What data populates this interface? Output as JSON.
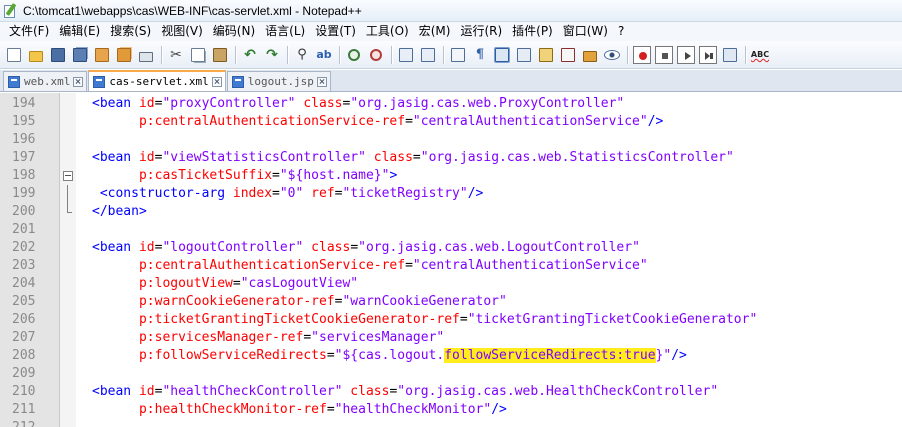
{
  "window": {
    "title": "C:\\tomcat1\\webapps\\cas\\WEB-INF\\cas-servlet.xml - Notepad++"
  },
  "menu": [
    "文件(F)",
    "编辑(E)",
    "搜索(S)",
    "视图(V)",
    "编码(N)",
    "语言(L)",
    "设置(T)",
    "工具(O)",
    "宏(M)",
    "运行(R)",
    "插件(P)",
    "窗口(W)",
    "?"
  ],
  "tabs": [
    {
      "label": "web.xml",
      "active": false
    },
    {
      "label": "cas-servlet.xml",
      "active": true
    },
    {
      "label": "logout.jsp",
      "active": false
    }
  ],
  "colors": {
    "tag": "#0000ff",
    "attribute": "#ff0000",
    "value": "#8000ff",
    "highlight": "#ffee1c",
    "active_tab_accent": "#f9a94a"
  },
  "lines": [
    {
      "n": "194",
      "fold": "",
      "tokens": [
        [
          "tag",
          "<bean "
        ],
        [
          "attr",
          "id"
        ],
        [
          "eq",
          "="
        ],
        [
          "val",
          "\"proxyController\""
        ],
        [
          "eq",
          " "
        ],
        [
          "attr",
          "class"
        ],
        [
          "eq",
          "="
        ],
        [
          "val",
          "\"org.jasig.cas.web.ProxyController\""
        ]
      ]
    },
    {
      "n": "195",
      "fold": "",
      "tokens": [
        [
          "eq",
          "      "
        ],
        [
          "attr",
          "p:centralAuthenticationService-ref"
        ],
        [
          "eq",
          "="
        ],
        [
          "val",
          "\"centralAuthenticationService\""
        ],
        [
          "tag",
          "/>"
        ]
      ]
    },
    {
      "n": "196",
      "fold": "",
      "tokens": []
    },
    {
      "n": "197",
      "fold": "",
      "tokens": [
        [
          "tag",
          "<bean "
        ],
        [
          "attr",
          "id"
        ],
        [
          "eq",
          "="
        ],
        [
          "val",
          "\"viewStatisticsController\""
        ],
        [
          "eq",
          " "
        ],
        [
          "attr",
          "class"
        ],
        [
          "eq",
          "="
        ],
        [
          "val",
          "\"org.jasig.cas.web.StatisticsController\""
        ]
      ]
    },
    {
      "n": "198",
      "fold": "box",
      "tokens": [
        [
          "eq",
          "      "
        ],
        [
          "attr",
          "p:casTicketSuffix"
        ],
        [
          "eq",
          "="
        ],
        [
          "val",
          "\"${host.name}\""
        ],
        [
          "tag",
          ">"
        ]
      ]
    },
    {
      "n": "199",
      "fold": "vline",
      "tokens": [
        [
          "eq",
          " "
        ],
        [
          "tag",
          "<constructor-arg "
        ],
        [
          "attr",
          "index"
        ],
        [
          "eq",
          "="
        ],
        [
          "val",
          "\"0\""
        ],
        [
          "eq",
          " "
        ],
        [
          "attr",
          "ref"
        ],
        [
          "eq",
          "="
        ],
        [
          "val",
          "\"ticketRegistry\""
        ],
        [
          "tag",
          "/>"
        ]
      ]
    },
    {
      "n": "200",
      "fold": "vend",
      "tokens": [
        [
          "tag",
          "</bean>"
        ]
      ]
    },
    {
      "n": "201",
      "fold": "",
      "tokens": []
    },
    {
      "n": "202",
      "fold": "",
      "tokens": [
        [
          "tag",
          "<bean "
        ],
        [
          "attr",
          "id"
        ],
        [
          "eq",
          "="
        ],
        [
          "val",
          "\"logoutController\""
        ],
        [
          "eq",
          " "
        ],
        [
          "attr",
          "class"
        ],
        [
          "eq",
          "="
        ],
        [
          "val",
          "\"org.jasig.cas.web.LogoutController\""
        ]
      ]
    },
    {
      "n": "203",
      "fold": "",
      "tokens": [
        [
          "eq",
          "      "
        ],
        [
          "attr",
          "p:centralAuthenticationService-ref"
        ],
        [
          "eq",
          "="
        ],
        [
          "val",
          "\"centralAuthenticationService\""
        ]
      ]
    },
    {
      "n": "204",
      "fold": "",
      "tokens": [
        [
          "eq",
          "      "
        ],
        [
          "attr",
          "p:logoutView"
        ],
        [
          "eq",
          "="
        ],
        [
          "val",
          "\"casLogoutView\""
        ]
      ]
    },
    {
      "n": "205",
      "fold": "",
      "tokens": [
        [
          "eq",
          "      "
        ],
        [
          "attr",
          "p:warnCookieGenerator-ref"
        ],
        [
          "eq",
          "="
        ],
        [
          "val",
          "\"warnCookieGenerator\""
        ]
      ]
    },
    {
      "n": "206",
      "fold": "",
      "tokens": [
        [
          "eq",
          "      "
        ],
        [
          "attr",
          "p:ticketGrantingTicketCookieGenerator-ref"
        ],
        [
          "eq",
          "="
        ],
        [
          "val",
          "\"ticketGrantingTicketCookieGenerator\""
        ]
      ]
    },
    {
      "n": "207",
      "fold": "",
      "tokens": [
        [
          "eq",
          "      "
        ],
        [
          "attr",
          "p:servicesManager-ref"
        ],
        [
          "eq",
          "="
        ],
        [
          "val",
          "\"servicesManager\""
        ]
      ]
    },
    {
      "n": "208",
      "fold": "",
      "tokens": [
        [
          "eq",
          "      "
        ],
        [
          "attr",
          "p:followServiceRedirects"
        ],
        [
          "eq",
          "="
        ],
        [
          "val",
          "\"${cas.logout."
        ],
        [
          "hl",
          "followServiceRedirects:true"
        ],
        [
          "val",
          "}\""
        ],
        [
          "tag",
          "/>"
        ]
      ]
    },
    {
      "n": "209",
      "fold": "",
      "tokens": []
    },
    {
      "n": "210",
      "fold": "",
      "tokens": [
        [
          "tag",
          "<bean "
        ],
        [
          "attr",
          "id"
        ],
        [
          "eq",
          "="
        ],
        [
          "val",
          "\"healthCheckController\""
        ],
        [
          "eq",
          " "
        ],
        [
          "attr",
          "class"
        ],
        [
          "eq",
          "="
        ],
        [
          "val",
          "\"org.jasig.cas.web.HealthCheckController\""
        ]
      ]
    },
    {
      "n": "211",
      "fold": "",
      "tokens": [
        [
          "eq",
          "      "
        ],
        [
          "attr",
          "p:healthCheckMonitor-ref"
        ],
        [
          "eq",
          "="
        ],
        [
          "val",
          "\"healthCheckMonitor\""
        ],
        [
          "tag",
          "/>"
        ]
      ]
    },
    {
      "n": "212",
      "fold": "",
      "tokens": []
    }
  ]
}
